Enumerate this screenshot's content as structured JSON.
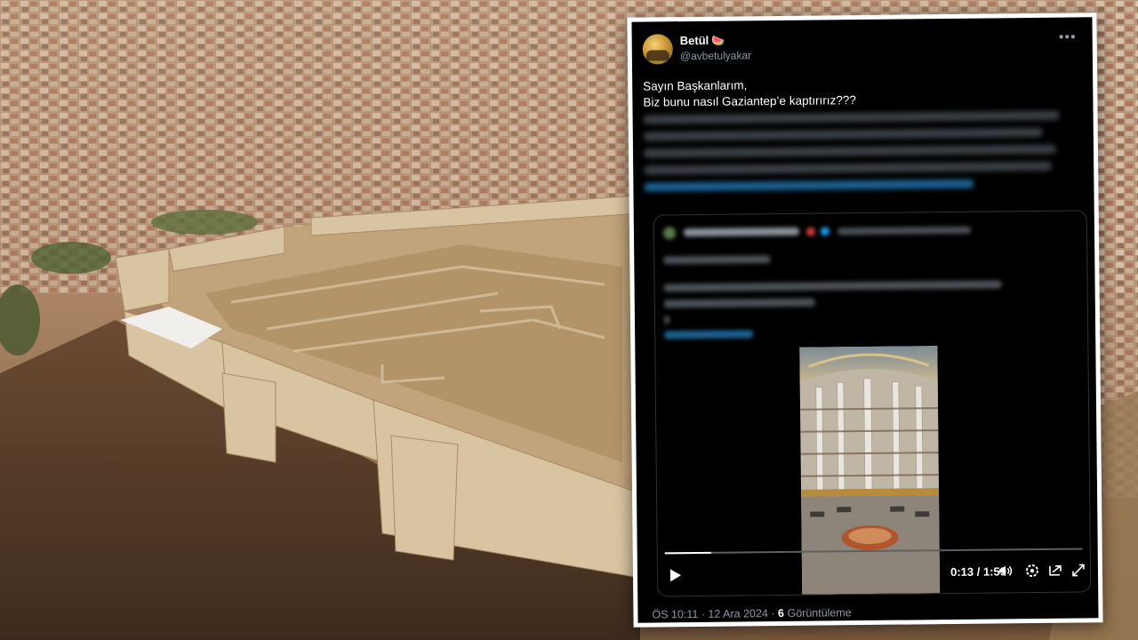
{
  "tweet": {
    "author_name": "Betül",
    "author_emoji": "🍉",
    "handle": "@avbetulyakar",
    "more_label": "•••",
    "text_line1": "Sayın Başkanlarım,",
    "text_line2": "Biz bunu nasıl Gaziantep’e kaptırırız???",
    "footer_time": "ÖS 10:11 · 12 Ara 2024 ·",
    "footer_views_count": "6",
    "footer_views_label": "Görüntüleme"
  },
  "video": {
    "current_time": "0:13",
    "duration": "1:59",
    "time_separator": "/",
    "progress": 0.11
  },
  "colors": {
    "tweet_bg": "#000000",
    "text_primary": "#ffffff",
    "text_secondary": "#8b98a5",
    "link": "#1d9bf0",
    "frame": "#ffffff"
  },
  "icons": {
    "play": "play-icon",
    "volume": "volume-icon",
    "settings": "settings-icon",
    "pip": "picture-in-picture-icon",
    "fullscreen": "fullscreen-icon",
    "more": "more-icon"
  }
}
